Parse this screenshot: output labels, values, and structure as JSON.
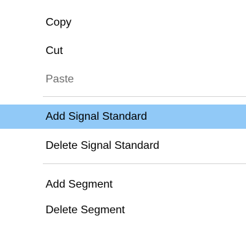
{
  "context_menu": {
    "items": [
      {
        "label": "Copy",
        "state": "enabled"
      },
      {
        "label": "Cut",
        "state": "enabled"
      },
      {
        "label": "Paste",
        "state": "disabled"
      },
      {
        "label": "Add Signal Standard",
        "state": "highlighted"
      },
      {
        "label": "Delete Signal Standard",
        "state": "enabled"
      },
      {
        "label": "Add Segment",
        "state": "enabled"
      },
      {
        "label": "Delete Segment",
        "state": "enabled"
      }
    ]
  },
  "colors": {
    "highlight": "#91c9f7",
    "disabled_text": "#6d6d6d",
    "separator": "#d7d7d7"
  }
}
